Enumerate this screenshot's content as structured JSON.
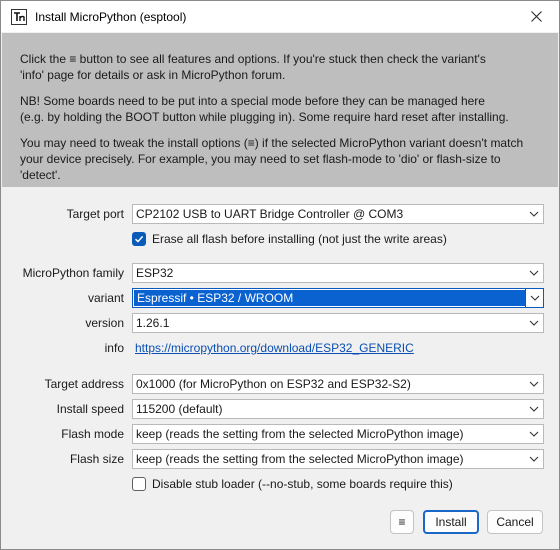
{
  "window": {
    "title": "Install MicroPython (esptool)"
  },
  "intro": {
    "paragraphs": [
      "Click the ≡ button to see all features and options. If you're stuck then check the variant's\n'info' page for details or ask in MicroPython forum.",
      "NB! Some boards need to be put into a special mode before they can be managed here\n(e.g. by holding the BOOT button while plugging in). Some require hard reset after installing.",
      "You may need to tweak the install options (≡) if the selected MicroPython variant doesn't match\nyour device precisely. For example, you may need to set flash-mode to 'dio' or flash-size to 'detect'."
    ]
  },
  "form": {
    "target_port": {
      "label": "Target port",
      "value": "CP2102 USB to UART Bridge Controller @ COM3"
    },
    "erase_flash": {
      "label": "Erase all flash before installing (not just the write areas)",
      "checked": true
    },
    "family": {
      "label": "MicroPython family",
      "value": "ESP32"
    },
    "variant": {
      "label": "variant",
      "value": "Espressif • ESP32 / WROOM"
    },
    "version": {
      "label": "version",
      "value": "1.26.1"
    },
    "info": {
      "label": "info",
      "link": "https://micropython.org/download/ESP32_GENERIC"
    },
    "target_address": {
      "label": "Target address",
      "value": "0x1000 (for MicroPython on ESP32 and ESP32-S2)"
    },
    "install_speed": {
      "label": "Install speed",
      "value": "115200 (default)"
    },
    "flash_mode": {
      "label": "Flash mode",
      "value": "keep (reads the setting from the selected MicroPython image)"
    },
    "flash_size": {
      "label": "Flash size",
      "value": "keep (reads the setting from the selected MicroPython image)"
    },
    "disable_stub": {
      "label": "Disable stub loader (--no-stub, some boards require this)",
      "checked": false
    }
  },
  "buttons": {
    "menu": "≡",
    "install": "Install",
    "cancel": "Cancel"
  },
  "colors": {
    "accent": "#0a62d1",
    "intro_background": "#bebebe",
    "link": "#0a4fb3"
  },
  "icons": {
    "app": "thonny-app-icon",
    "close": "close-icon",
    "dropdown": "chevron-down-icon",
    "check": "check-icon"
  }
}
